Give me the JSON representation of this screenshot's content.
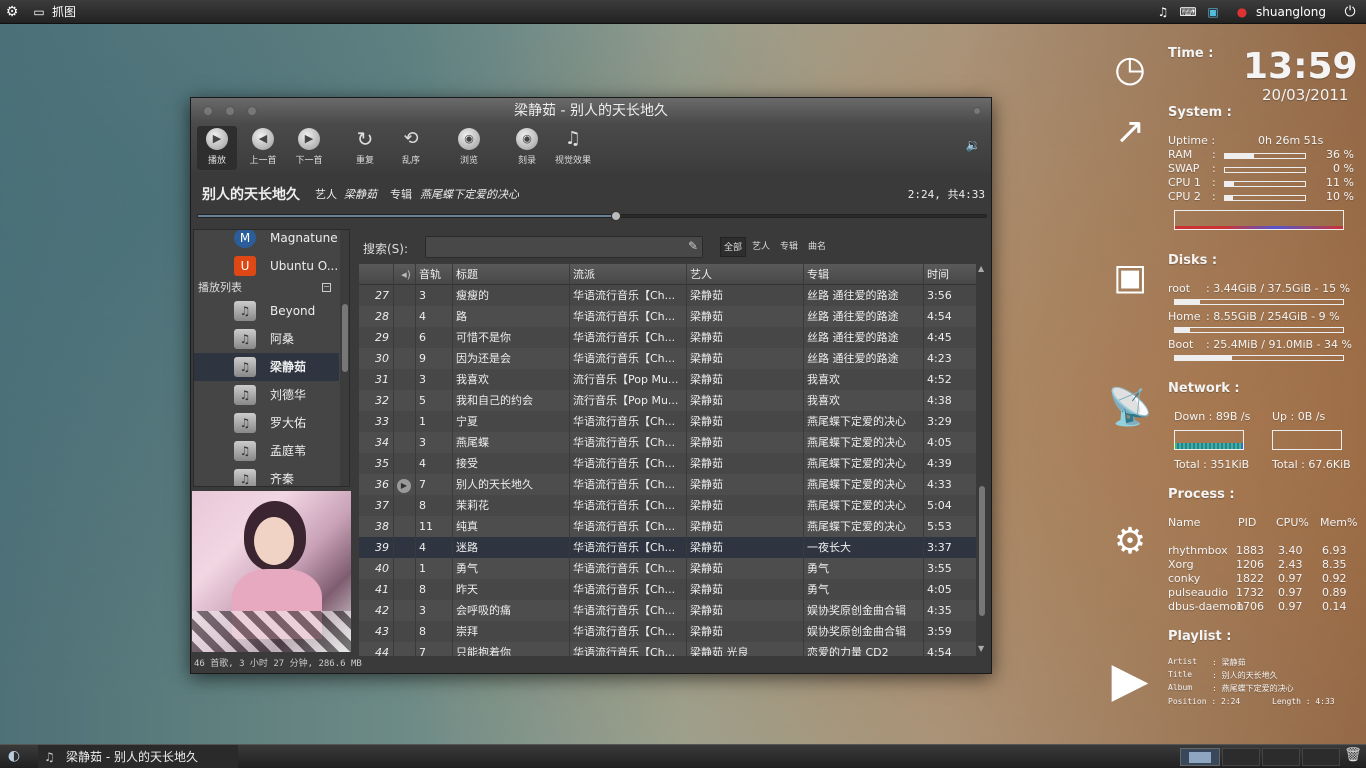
{
  "topbar": {
    "app_label": "抓图",
    "username": "shuanglong"
  },
  "window": {
    "title": "梁静茹  -  别人的天长地久",
    "toolbar": [
      "播放",
      "上一首",
      "下一首",
      "重复",
      "乱序",
      "浏览",
      "刻录",
      "视觉效果"
    ],
    "toolbar_icons": [
      "play-icon",
      "previous-icon",
      "next-icon",
      "repeat-icon",
      "shuffle-icon",
      "browse-icon",
      "burn-icon",
      "visual-effects-icon"
    ],
    "now_playing": {
      "song": "别人的天长地久",
      "artist_label": "艺人",
      "artist": "梁静茹",
      "album_label": "专辑",
      "album": "燕尾蝶下定爱的决心",
      "time": "2:24, 共4:33",
      "progress": 0.53
    },
    "sidebar": {
      "sources": [
        "Magnatune",
        "Ubuntu O..."
      ],
      "playlist_header": "播放列表",
      "playlists": [
        "Beyond",
        "阿桑",
        "梁静茹",
        "刘德华",
        "罗大佑",
        "孟庭苇",
        "齐秦"
      ],
      "selected": 2
    },
    "search": {
      "label": "搜索(S):",
      "placeholder": "",
      "filters": [
        "全部",
        "艺人",
        "专辑",
        "曲名"
      ]
    },
    "columns": [
      "",
      "音轨",
      "标题",
      "流派",
      "艺人",
      "专辑",
      "时间"
    ],
    "rows": [
      [
        "27",
        "3",
        "瘦瘦的",
        "华语流行音乐【Ch...",
        "梁静茹",
        "丝路  通往爱的路途",
        "3:56"
      ],
      [
        "28",
        "4",
        "路",
        "华语流行音乐【Ch...",
        "梁静茹",
        "丝路  通往爱的路途",
        "4:54"
      ],
      [
        "29",
        "6",
        "可惜不是你",
        "华语流行音乐【Ch...",
        "梁静茹",
        "丝路  通往爱的路途",
        "4:45"
      ],
      [
        "30",
        "9",
        "因为还是会",
        "华语流行音乐【Ch...",
        "梁静茹",
        "丝路  通往爱的路途",
        "4:23"
      ],
      [
        "31",
        "3",
        "我喜欢",
        "流行音乐【Pop Mu...",
        "梁静茹",
        "我喜欢",
        "4:52"
      ],
      [
        "32",
        "5",
        "我和自己的约会",
        "流行音乐【Pop Mu...",
        "梁静茹",
        "我喜欢",
        "4:38"
      ],
      [
        "33",
        "1",
        "宁夏",
        "华语流行音乐【Ch...",
        "梁静茹",
        "燕尾蝶下定爱的决心",
        "3:29"
      ],
      [
        "34",
        "3",
        "燕尾蝶",
        "华语流行音乐【Ch...",
        "梁静茹",
        "燕尾蝶下定爱的决心",
        "4:05"
      ],
      [
        "35",
        "4",
        "接受",
        "华语流行音乐【Ch...",
        "梁静茹",
        "燕尾蝶下定爱的决心",
        "4:39"
      ],
      [
        "36",
        "7",
        "别人的天长地久",
        "华语流行音乐【Ch...",
        "梁静茹",
        "燕尾蝶下定爱的决心",
        "4:33"
      ],
      [
        "37",
        "8",
        "茉莉花",
        "华语流行音乐【Ch...",
        "梁静茹",
        "燕尾蝶下定爱的决心",
        "5:04"
      ],
      [
        "38",
        "11",
        "纯真",
        "华语流行音乐【Ch...",
        "梁静茹",
        "燕尾蝶下定爱的决心",
        "5:53"
      ],
      [
        "39",
        "4",
        "迷路",
        "华语流行音乐【Ch...",
        "梁静茹",
        "一夜长大",
        "3:37"
      ],
      [
        "40",
        "1",
        "勇气",
        "华语流行音乐【Ch...",
        "梁静茹",
        "勇气",
        "3:55"
      ],
      [
        "41",
        "8",
        "昨天",
        "华语流行音乐【Ch...",
        "梁静茹",
        "勇气",
        "4:05"
      ],
      [
        "42",
        "3",
        "会呼吸的痛",
        "华语流行音乐【Ch...",
        "梁静茹",
        "娱协奖原创金曲合辑",
        "4:35"
      ],
      [
        "43",
        "8",
        "崇拜",
        "华语流行音乐【Ch...",
        "梁静茹",
        "娱协奖原创金曲合辑",
        "3:59"
      ],
      [
        "44",
        "7",
        "只能抱着你",
        "华语流行音乐【Ch...",
        "梁静茹  光良",
        "恋爱的力量  CD2",
        "4:54"
      ]
    ],
    "playing_row": 9,
    "selected_row": 12,
    "status": "46 首歌, 3 小时 27 分钟, 286.6 MB"
  },
  "conky": {
    "time_label": "Time :",
    "clock": "13:59",
    "date": "20/03/2011",
    "system_label": "System :",
    "uptime_label": "Uptime :",
    "uptime": "0h 26m 51s",
    "stats": [
      {
        "name": "RAM",
        "sep": ":",
        "value": "36 %",
        "level": 0.36
      },
      {
        "name": "SWAP",
        "sep": ":",
        "value": "0 %",
        "level": 0.0
      },
      {
        "name": "CPU 1",
        "sep": ":",
        "value": "11 %",
        "level": 0.11
      },
      {
        "name": "CPU 2",
        "sep": ":",
        "value": "10 %",
        "level": 0.1
      }
    ],
    "disks_label": "Disks :",
    "disks": [
      {
        "name": "root",
        "text": ": 3.44GiB / 37.5GiB - 15 %",
        "level": 0.15
      },
      {
        "name": "Home",
        "text": ": 8.55GiB / 254GiB - 9 %",
        "level": 0.09
      },
      {
        "name": "Boot",
        "text": ": 25.4MiB / 91.0MiB - 34 %",
        "level": 0.34
      }
    ],
    "network_label": "Network :",
    "down": "Down : 89B  /s",
    "up": "Up : 0B  /s",
    "total_down": "Total : 351KiB",
    "total_up": "Total : 67.6KiB",
    "process_label": "Process :",
    "proc_cols": [
      "Name",
      "PID",
      "CPU%",
      "Mem%"
    ],
    "procs": [
      [
        "rhythmbox",
        "1883",
        "3.40",
        "6.93"
      ],
      [
        "Xorg",
        "1206",
        "2.43",
        "8.35"
      ],
      [
        "conky",
        "1822",
        "0.97",
        "0.92"
      ],
      [
        "pulseaudio",
        "1732",
        "0.97",
        "0.89"
      ],
      [
        "dbus-daemon",
        "1706",
        "0.97",
        "0.14"
      ]
    ],
    "playlist_label": "Playlist :",
    "pl_artist_label": "Artist",
    "pl_artist": ": 梁静茹",
    "pl_title_label": "Title",
    "pl_title": ": 别人的天长地久",
    "pl_album_label": "Album",
    "pl_album": ": 燕尾蝶下定爱的决心",
    "pl_position": "Position : 2:24",
    "pl_length": "Length  : 4:33"
  },
  "taskbar": {
    "task": "梁静茹  -  别人的天长地久"
  }
}
